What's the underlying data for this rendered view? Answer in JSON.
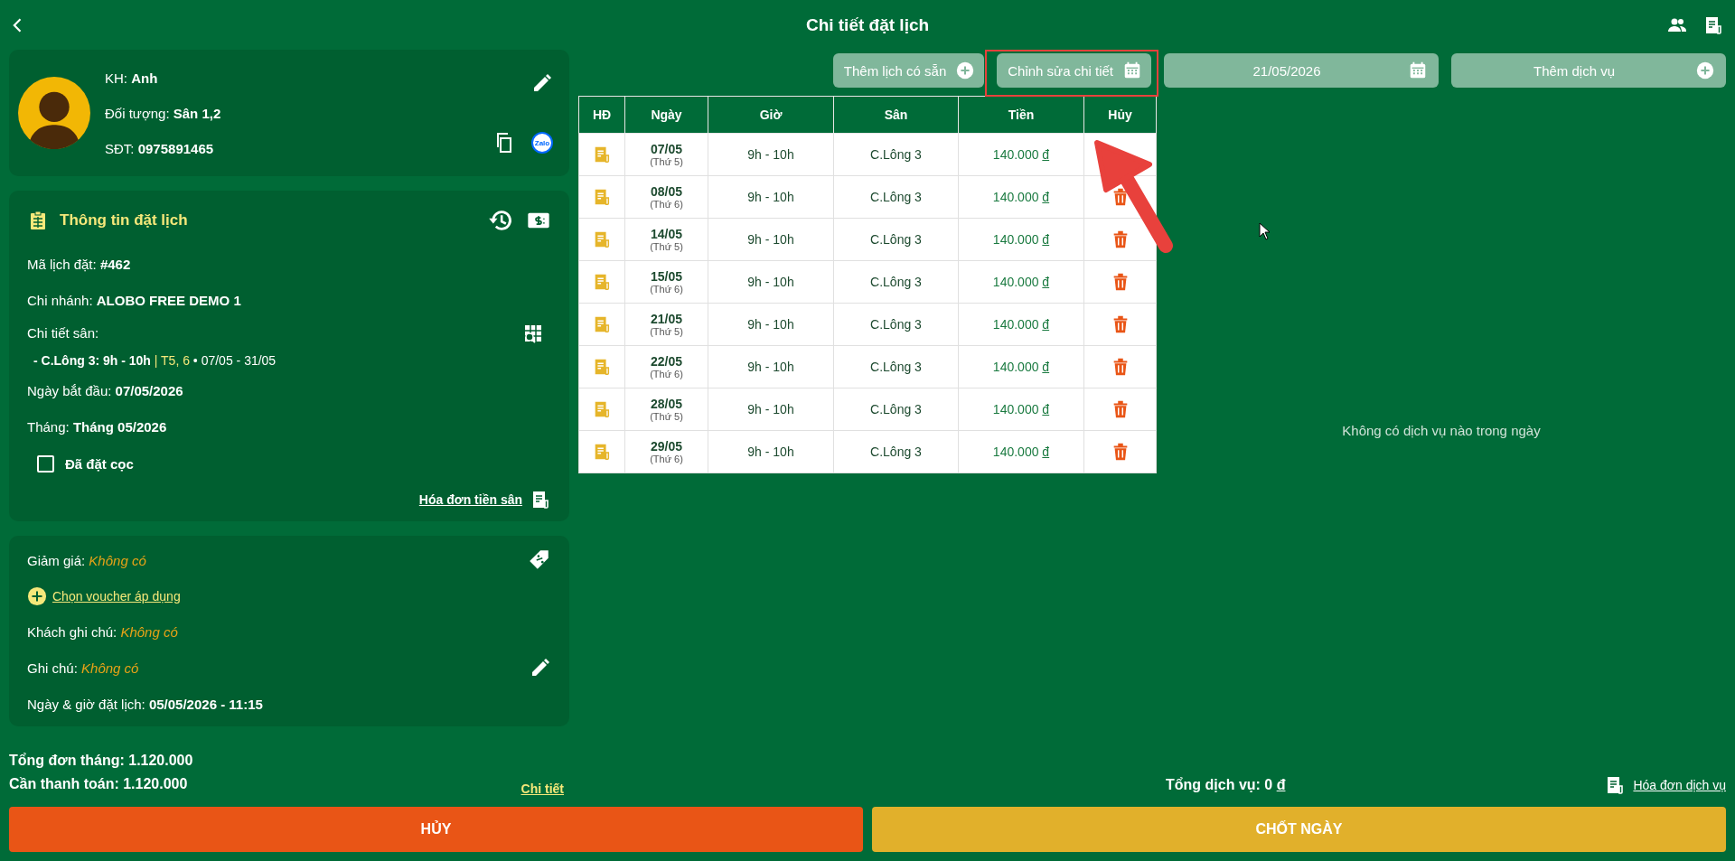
{
  "header": {
    "title": "Chi tiết đặt lịch"
  },
  "customer": {
    "name_label": "KH:",
    "name": "Anh",
    "target_label": "Đối tượng:",
    "target": "Sân 1,2",
    "phone_label": "SĐT:",
    "phone": "0975891465",
    "chat_badge": "Zalo"
  },
  "booking": {
    "title": "Thông tin đặt lịch",
    "rows": [
      {
        "kind": "field",
        "label": "Mã lịch đặt:",
        "value": "#462"
      },
      {
        "kind": "field",
        "label": "Chi nhánh:",
        "value": "ALOBO FREE DEMO 1"
      },
      {
        "kind": "court",
        "label": "Chi tiết sân:",
        "line": "- C.Lông 3: 9h - 10h",
        "separator": "|",
        "days": "T5, 6",
        "dates": "• 07/05 - 31/05"
      },
      {
        "kind": "field",
        "label": "Ngày bắt đầu:",
        "value": "07/05/2026"
      },
      {
        "kind": "field",
        "label": "Tháng:",
        "value": "Tháng 05/2026"
      }
    ],
    "deposit": {
      "label": "Đã đặt cọc",
      "checked": false
    },
    "invoice_link": "Hóa đơn tiền sân"
  },
  "notes": {
    "rows": [
      {
        "kind": "note",
        "label": "Giảm giá:",
        "value": "Không có"
      },
      {
        "kind": "link",
        "label": "Chọn voucher áp dụng"
      },
      {
        "kind": "note",
        "label": "Khách ghi chú:",
        "value": "Không có"
      },
      {
        "kind": "note",
        "label": "Ghi chú:",
        "value": "Không có"
      },
      {
        "kind": "field",
        "label": "Ngày & giờ đặt lịch:",
        "value": "05/05/2026 - 11:15"
      }
    ]
  },
  "totals": {
    "month_total": "Tổng đơn tháng: 1.120.000",
    "to_pay": "Cần thanh toán: 1.120.000",
    "detail_link": "Chi tiết"
  },
  "actions": {
    "add_available": "Thêm lịch có sẵn",
    "edit_detail": "Chỉnh sửa chi tiết",
    "date": "21/05/2026",
    "add_service": "Thêm dịch vụ"
  },
  "table": {
    "columns": [
      "HĐ",
      "Ngày",
      "Giờ",
      "Sân",
      "Tiền",
      "Hủy"
    ],
    "rows": [
      {
        "date": "07/05",
        "weekday": "(Thứ 5)",
        "time": "9h - 10h",
        "court": "C.Lông 3",
        "amount": "140.000",
        "currency": "đ",
        "delete_icon": false
      },
      {
        "date": "08/05",
        "weekday": "(Thứ 6)",
        "time": "9h - 10h",
        "court": "C.Lông 3",
        "amount": "140.000",
        "currency": "đ",
        "delete_icon": true
      },
      {
        "date": "14/05",
        "weekday": "(Thứ 5)",
        "time": "9h - 10h",
        "court": "C.Lông 3",
        "amount": "140.000",
        "currency": "đ",
        "delete_icon": true
      },
      {
        "date": "15/05",
        "weekday": "(Thứ 6)",
        "time": "9h - 10h",
        "court": "C.Lông 3",
        "amount": "140.000",
        "currency": "đ",
        "delete_icon": true
      },
      {
        "date": "21/05",
        "weekday": "(Thứ 5)",
        "time": "9h - 10h",
        "court": "C.Lông 3",
        "amount": "140.000",
        "currency": "đ",
        "delete_icon": true
      },
      {
        "date": "22/05",
        "weekday": "(Thứ 6)",
        "time": "9h - 10h",
        "court": "C.Lông 3",
        "amount": "140.000",
        "currency": "đ",
        "delete_icon": true
      },
      {
        "date": "28/05",
        "weekday": "(Thứ 5)",
        "time": "9h - 10h",
        "court": "C.Lông 3",
        "amount": "140.000",
        "currency": "đ",
        "delete_icon": true
      },
      {
        "date": "29/05",
        "weekday": "(Thứ 6)",
        "time": "9h - 10h",
        "court": "C.Lông 3",
        "amount": "140.000",
        "currency": "đ",
        "delete_icon": true
      }
    ]
  },
  "services": {
    "empty_message": "Không có dịch vụ nào trong ngày",
    "total_label": "Tổng dịch vụ: 0",
    "currency": "đ",
    "invoice_link": "Hóa đơn dịch vụ"
  },
  "footer": {
    "cancel": "HỦY",
    "close_day": "CHỐT NGÀY"
  }
}
